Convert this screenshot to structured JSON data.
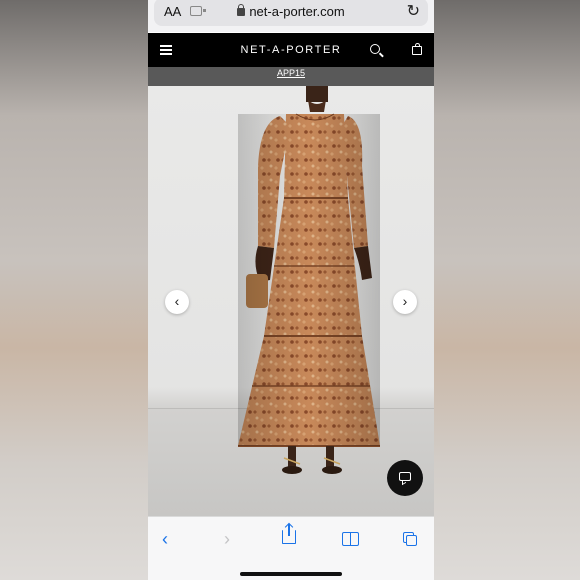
{
  "browser": {
    "text_size_label": "AA",
    "url": "net-a-porter.com",
    "reload_icon": "reload-icon"
  },
  "header": {
    "brand": "NET-A-PORTER",
    "menu_icon": "hamburger-menu-icon",
    "search_icon": "search-icon",
    "bag_icon": "shopping-bag-icon"
  },
  "promo": {
    "code": "APP15"
  },
  "gallery": {
    "prev_icon": "chevron-left-icon",
    "next_icon": "chevron-right-icon",
    "prev_glyph": "‹",
    "next_glyph": "›"
  },
  "chat": {
    "icon": "chat-icon"
  },
  "toolbar": {
    "back_glyph": "‹",
    "forward_glyph": "›",
    "share_icon": "share-icon",
    "bookmarks_icon": "bookmarks-icon",
    "tabs_icon": "tabs-icon"
  },
  "colors": {
    "header_bg": "#000000",
    "promo_bg": "#595959",
    "safari_blue": "#1a73e8",
    "dress_primary": "#c8895a"
  }
}
